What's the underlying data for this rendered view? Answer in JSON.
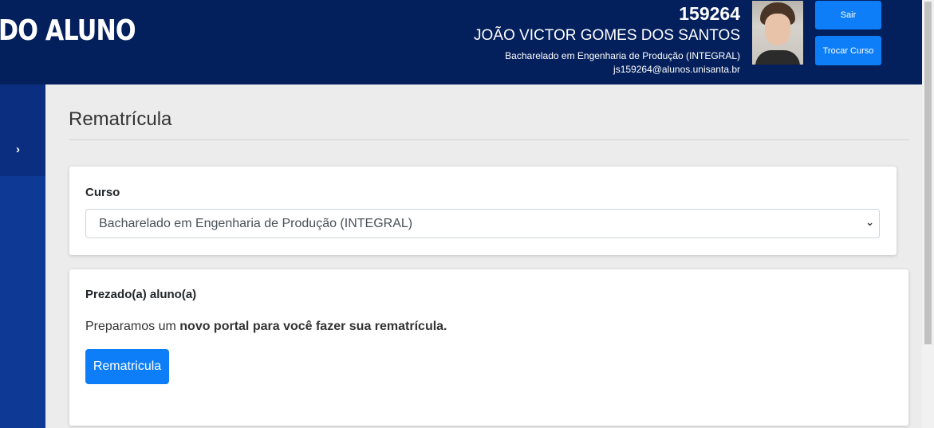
{
  "header": {
    "brand": "DO ALUNO",
    "user": {
      "id": "159264",
      "name": "JOÃO VICTOR GOMES DOS SANTOS",
      "course": "Bacharelado em Engenharia de Produção (INTEGRAL)",
      "email": "js159264@alunos.unisanta.br"
    },
    "buttons": {
      "logout": "Sair",
      "change_course": "Trocar Curso"
    }
  },
  "sidebar": {
    "toggle_icon": "chevron-right-icon"
  },
  "main": {
    "title": "Rematrícula",
    "course_card": {
      "label": "Curso",
      "selected": "Bacharelado em Engenharia de Produção (INTEGRAL)"
    },
    "message_card": {
      "title": "Prezado(a) aluno(a)",
      "text_plain": "Preparamos um ",
      "text_bold": "novo portal para você fazer sua rematrícula.",
      "button": "Rematricula"
    }
  },
  "colors": {
    "header_bg": "#04205c",
    "sidebar_bg": "#0e3a96",
    "primary": "#0d7ef8",
    "page_bg": "#ececec"
  }
}
